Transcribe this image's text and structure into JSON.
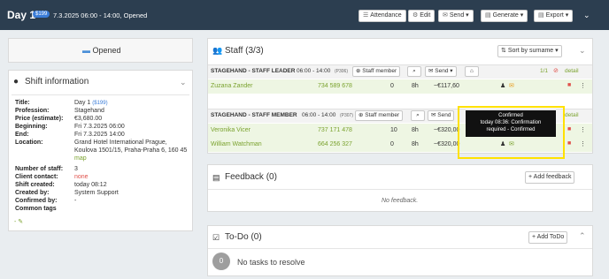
{
  "header": {
    "title": "Day 1",
    "badge": "$199",
    "subtitle": "7.3.2025 06:00 - 14:00, Opened",
    "buttons": {
      "attendance": "Attendance",
      "edit": "Edit",
      "send": "Send",
      "generate": "Generate",
      "export": "Export"
    }
  },
  "status_box": {
    "label": "Opened"
  },
  "shift_info": {
    "title": "Shift information",
    "rows": [
      {
        "label": "Title:",
        "value": "Day 1",
        "extra": "($199)"
      },
      {
        "label": "Profession:",
        "value": "Stagehand"
      },
      {
        "label": "Price (estimate):",
        "value": "€3,680.00"
      },
      {
        "label": "Beginning:",
        "value": "Fri 7.3.2025 06:00"
      },
      {
        "label": "End:",
        "value": "Fri 7.3.2025 14:00"
      },
      {
        "label": "Location:",
        "value": "Grand Hotel International Prague,",
        "value2": "Koulova 1501/15, Praha-Praha 6, 160 45",
        "link": "map"
      },
      {
        "label": "Number of staff:",
        "value": "3"
      },
      {
        "label": "Client contact:",
        "value": "none"
      },
      {
        "label": "Shift created:",
        "value": "today 08:12"
      },
      {
        "label": "Created by:",
        "value": "System Support"
      },
      {
        "label": "Confirmed by:",
        "value": "-"
      },
      {
        "label": "Common tags",
        "value": ""
      }
    ]
  },
  "staff": {
    "title": "Staff (3/3)",
    "sort": "Sort by surname",
    "groups": [
      {
        "name": "STAGEHAND - STAFF LEADER",
        "time": "06:00 - 14:00",
        "code": "(P306)",
        "add": "Staff member",
        "send": "Send",
        "count": "1/1",
        "detail": "detail",
        "rows": [
          {
            "name": "Zuzana Zander",
            "phone": "734 589 678",
            "n": "0",
            "h": "8h",
            "amount": "~€117,60"
          }
        ]
      },
      {
        "name": "STAGEHAND - STAFF MEMBER",
        "time": "06:00 - 14:00",
        "code": "(P307)",
        "add": "Staff member",
        "send": "Send",
        "detail": "detail",
        "rows": [
          {
            "name": "Veronika Vicer",
            "phone": "737 171 478",
            "n": "10",
            "h": "8h",
            "amount": "~€320,00"
          },
          {
            "name": "William Watchman",
            "phone": "664 256 327",
            "n": "0",
            "h": "8h",
            "amount": "~€320,00"
          }
        ]
      }
    ],
    "tooltip": {
      "line1": "Confirmed",
      "line2": "today 08:36: Confirmation",
      "line3": "required - Confirmed"
    }
  },
  "feedback": {
    "title": "Feedback (0)",
    "add": "Add feedback",
    "empty": "No feedback."
  },
  "todo": {
    "title": "To-Do (0)",
    "add": "Add ToDo",
    "count": "0",
    "empty": "No tasks to resolve"
  }
}
